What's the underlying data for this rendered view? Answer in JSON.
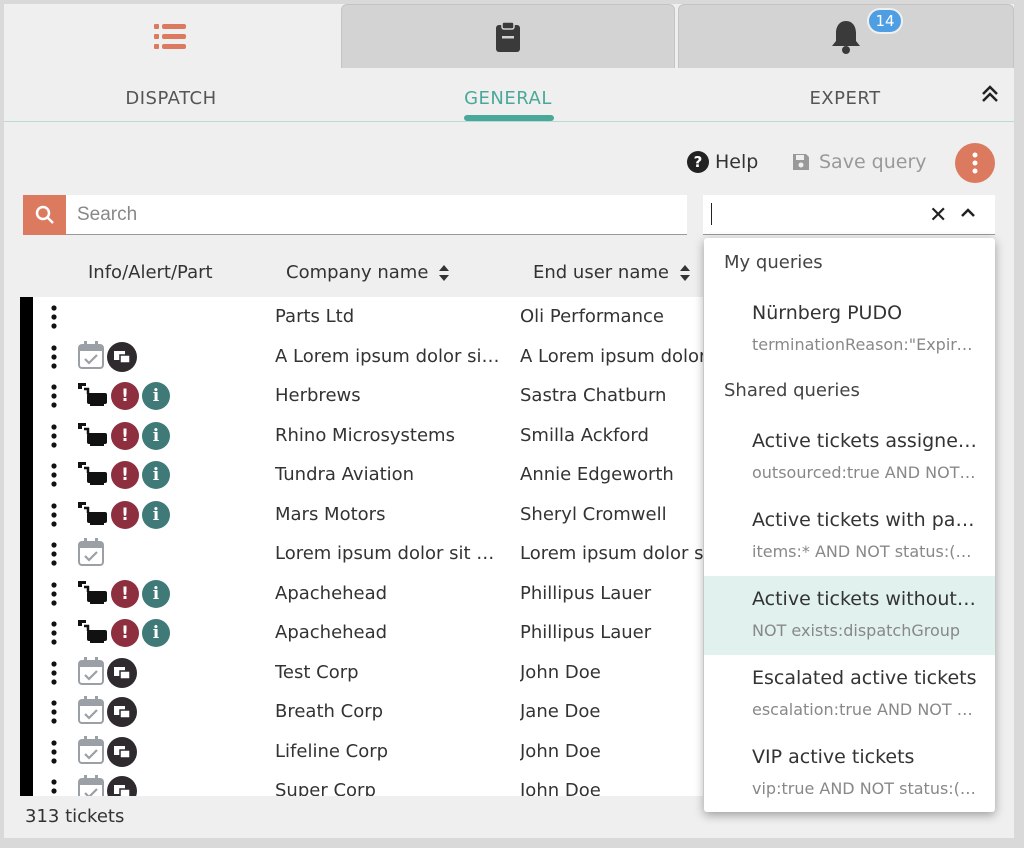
{
  "top_tabs": [
    {
      "name": "list",
      "icon": "list-icon"
    },
    {
      "name": "clipboard",
      "icon": "clipboard-icon"
    },
    {
      "name": "notifications",
      "icon": "bell-icon",
      "badge": "14"
    }
  ],
  "sub_tabs": [
    "DISPATCH",
    "GENERAL",
    "EXPERT"
  ],
  "toolbar": {
    "help_label": "Help",
    "save_label": "Save query"
  },
  "search": {
    "placeholder": "Search",
    "value": ""
  },
  "table": {
    "headers": [
      "Info/Alert/Part",
      "Company name",
      "End user name"
    ],
    "rows": [
      {
        "company": "Parts Ltd",
        "user": "Oli Performance",
        "icons": []
      },
      {
        "company": "A Lorem ipsum dolor sit amet",
        "user": "A Lorem ipsum dolor",
        "icons": [
          "calendar",
          "window"
        ]
      },
      {
        "company": "Herbrews",
        "user": "Sastra Chatburn",
        "icons": [
          "truck",
          "alert",
          "info"
        ]
      },
      {
        "company": "Rhino Microsystems",
        "user": "Smilla Ackford",
        "icons": [
          "truck",
          "alert",
          "info"
        ]
      },
      {
        "company": "Tundra Aviation",
        "user": "Annie Edgeworth",
        "icons": [
          "truck",
          "alert",
          "info"
        ]
      },
      {
        "company": "Mars Motors",
        "user": "Sheryl Cromwell",
        "icons": [
          "truck",
          "alert",
          "info"
        ]
      },
      {
        "company": "Lorem ipsum dolor sit amet",
        "user": "Lorem ipsum dolor si",
        "icons": [
          "calendar"
        ]
      },
      {
        "company": "Apachehead",
        "user": "Phillipus Lauer",
        "icons": [
          "truck",
          "alert",
          "info"
        ]
      },
      {
        "company": "Apachehead",
        "user": "Phillipus Lauer",
        "icons": [
          "truck",
          "alert",
          "info"
        ]
      },
      {
        "company": "Test Corp",
        "user": "John Doe",
        "icons": [
          "calendar",
          "window"
        ]
      },
      {
        "company": "Breath Corp",
        "user": "Jane Doe",
        "icons": [
          "calendar",
          "window"
        ]
      },
      {
        "company": "Lifeline Corp",
        "user": "John Doe",
        "icons": [
          "calendar",
          "window"
        ]
      },
      {
        "company": "Super Corp",
        "user": "John Doe",
        "icons": [
          "calendar",
          "window"
        ]
      }
    ]
  },
  "footer": {
    "count": "313 tickets"
  },
  "dropdown": {
    "my_label": "My queries",
    "shared_label": "Shared queries",
    "my_queries": [
      {
        "title": "Nürnberg PUDO",
        "query": "terminationReason:\"Expired\""
      }
    ],
    "shared_queries": [
      {
        "title": "Active tickets assigned to me",
        "query": "outsourced:true AND NOT status:closed"
      },
      {
        "title": "Active tickets with parts",
        "query": "items:* AND NOT status:(closed)"
      },
      {
        "title": "Active tickets without dispatch group",
        "query": "NOT exists:dispatchGroup"
      },
      {
        "title": "Escalated active tickets",
        "query": "escalation:true AND NOT status:closed"
      },
      {
        "title": "VIP active tickets",
        "query": "vip:true AND NOT status:(closed)"
      }
    ]
  },
  "colors": {
    "accent": "#dc7a5f",
    "teal": "#4aa89b",
    "alert": "#8d2f3e",
    "info": "#3f7a78",
    "badge": "#4e9ee3",
    "highlight": "#e1f1ee"
  }
}
